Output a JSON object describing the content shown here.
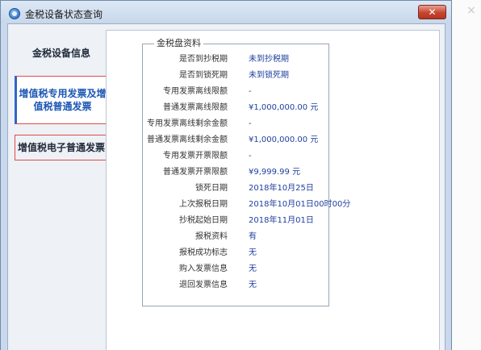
{
  "window": {
    "title": "金税设备状态查询",
    "close_label": "✕"
  },
  "nav": {
    "items": [
      {
        "label": "金税设备信息"
      },
      {
        "label": "增值税专用发票及增值税普通发票"
      },
      {
        "label": "增值税电子普通发票"
      }
    ]
  },
  "panel": {
    "group_title": "金税盘资料",
    "rows": [
      {
        "label": "是否到抄税期",
        "value": "未到抄税期"
      },
      {
        "label": "是否到锁死期",
        "value": "未到锁死期"
      },
      {
        "label": "专用发票离线限额",
        "value": "-"
      },
      {
        "label": "普通发票离线限额",
        "value": "¥1,000,000.00 元"
      },
      {
        "label": "专用发票离线剩余金额",
        "value": "-"
      },
      {
        "label": "普通发票离线剩余金额",
        "value": "¥1,000,000.00 元"
      },
      {
        "label": "专用发票开票限额",
        "value": "-"
      },
      {
        "label": "普通发票开票限额",
        "value": "¥9,999.99 元"
      },
      {
        "label": "锁死日期",
        "value": "2018年10月25日"
      },
      {
        "label": "上次报税日期",
        "value": "2018年10月01日00时00分"
      },
      {
        "label": "抄税起始日期",
        "value": "2018年11月01日"
      },
      {
        "label": "报税资料",
        "value": "有"
      },
      {
        "label": "报税成功标志",
        "value": "无"
      },
      {
        "label": "购入发票信息",
        "value": "无"
      },
      {
        "label": "退回发票信息",
        "value": "无"
      }
    ]
  },
  "desktop": {
    "close_label": "×"
  },
  "colors": {
    "title_bar": "#c7d7ea",
    "active_nav_text": "#1c57b4",
    "value_text": "#1f3f9e",
    "highlight_border": "#e04a4a",
    "close_button": "#c6452f"
  }
}
